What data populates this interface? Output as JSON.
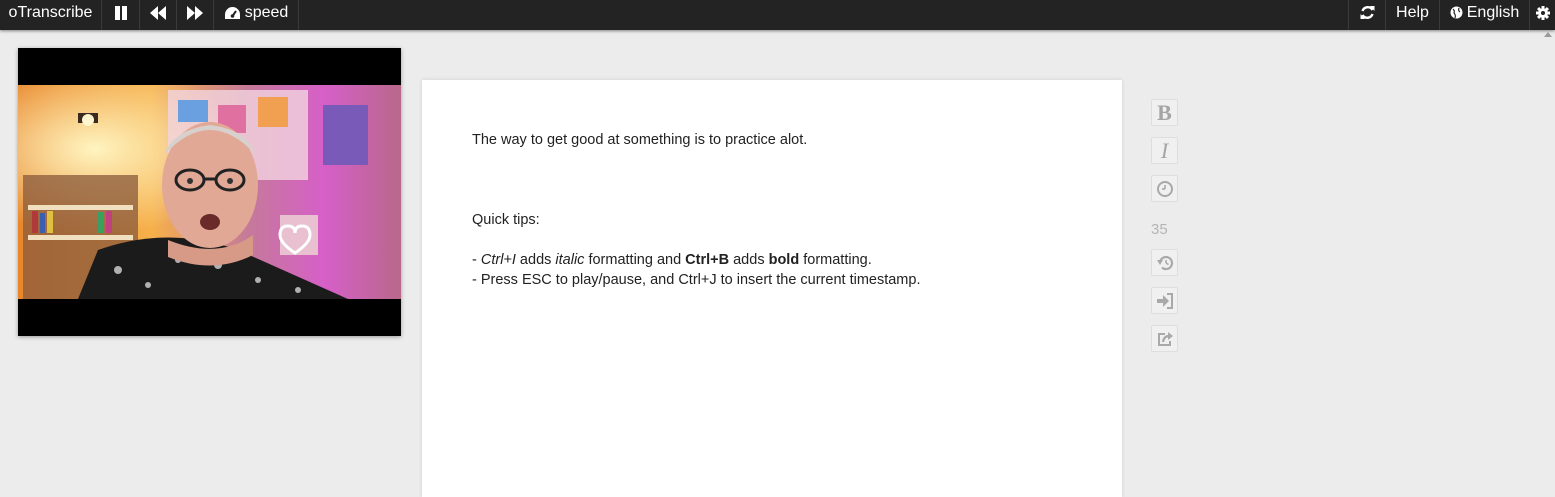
{
  "topbar": {
    "app_name": "oTranscribe",
    "pause_icon": "pause-icon",
    "rewind_icon": "rewind-icon",
    "forward_icon": "fast-forward-icon",
    "speed_icon": "tachometer-icon",
    "speed_label": "speed",
    "refresh_icon": "refresh-icon",
    "help_label": "Help",
    "language_icon": "globe-icon",
    "language_label": "English",
    "settings_icon": "gear-icon"
  },
  "video": {
    "description_icon": "video-player"
  },
  "editor": {
    "line1": "The way to get good at something is to practice alot.",
    "tips_heading": "Quick tips:",
    "tip1": {
      "dash": "- ",
      "ctrl_i": "Ctrl+I",
      "adds1": " adds ",
      "italic": "italic",
      "formatting_and": " formatting and ",
      "ctrl_b": "Ctrl+B",
      "adds2": " adds ",
      "bold": "bold",
      "formatting_end": " formatting."
    },
    "tip2": "- Press ESC to play/pause, and Ctrl+J to insert the current timestamp."
  },
  "side_controls": {
    "bold_label": "B",
    "italic_label": "I",
    "timestamp_icon": "clock-icon",
    "rewind_seconds": "35",
    "history_icon": "history-icon",
    "import_icon": "sign-in-icon",
    "export_icon": "share-icon"
  },
  "colors": {
    "topbar_bg": "#232323",
    "page_bg": "#ececec",
    "editor_bg": "#ffffff",
    "side_icon": "#a9a9a9"
  }
}
